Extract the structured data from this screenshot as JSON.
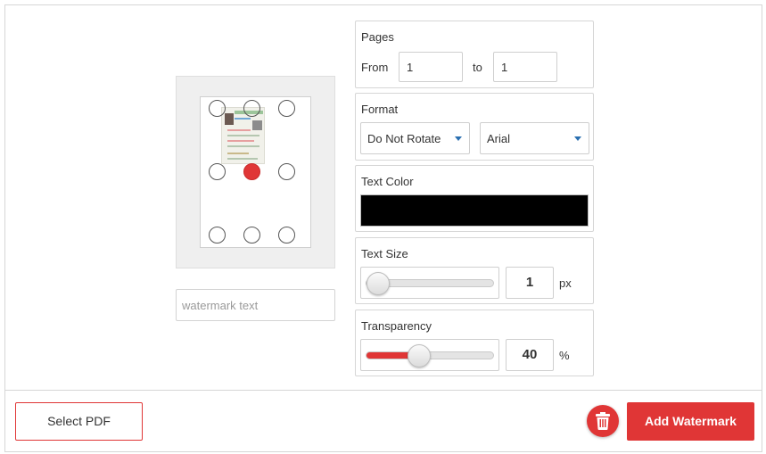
{
  "pages": {
    "title": "Pages",
    "from_label": "From",
    "from_value": "1",
    "to_label": "to",
    "to_value": "1"
  },
  "format": {
    "title": "Format",
    "rotation_selected": "Do Not Rotate",
    "font_selected": "Arial"
  },
  "text_color": {
    "title": "Text Color",
    "value": "#000000"
  },
  "text_size": {
    "title": "Text Size",
    "value": "1",
    "unit": "px",
    "slider_fraction": 0.0
  },
  "transparency": {
    "title": "Transparency",
    "value": "40",
    "unit": "%",
    "slider_fraction": 0.4
  },
  "watermark": {
    "placeholder": "watermark text",
    "selected_position": "middle-center",
    "positions": [
      "top-left",
      "top-center",
      "top-right",
      "middle-left",
      "middle-center",
      "middle-right",
      "bottom-left",
      "bottom-center",
      "bottom-right"
    ]
  },
  "actions": {
    "select_pdf_label": "Select PDF",
    "add_watermark_label": "Add Watermark"
  },
  "colors": {
    "accent": "#e03636",
    "border": "#d6d6d6"
  }
}
